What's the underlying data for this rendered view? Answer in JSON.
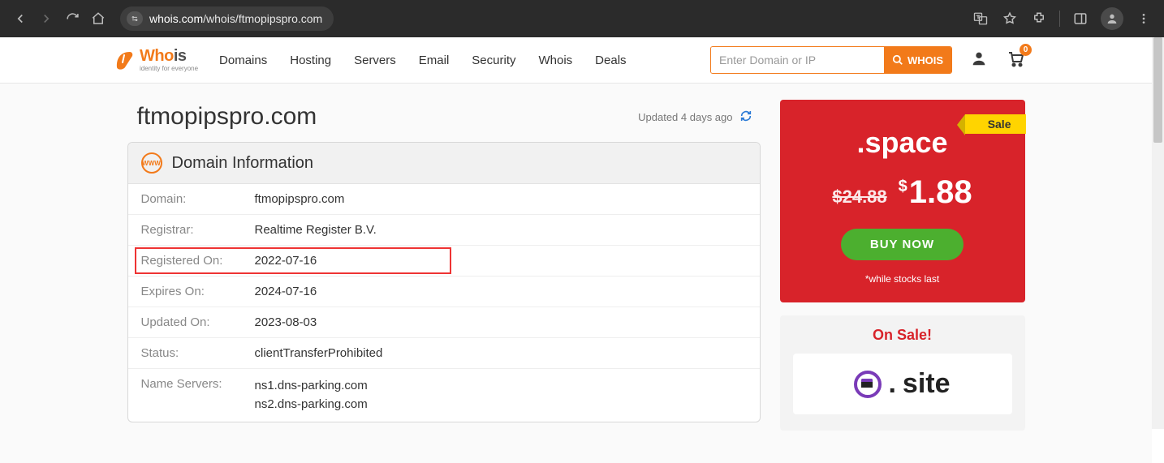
{
  "chrome": {
    "url_domain": "whois.com",
    "url_path": "/whois/ftmopipspro.com"
  },
  "logo": {
    "word_o": "Wh",
    "word_o2": "o",
    "word_rest": "is",
    "tagline": "identity for everyone"
  },
  "nav": {
    "items": [
      "Domains",
      "Hosting",
      "Servers",
      "Email",
      "Security",
      "Whois",
      "Deals"
    ]
  },
  "search": {
    "placeholder": "Enter Domain or IP",
    "button": "WHOIS"
  },
  "cart": {
    "count": "0"
  },
  "page": {
    "title": "ftmopipspro.com",
    "updated": "Updated 4 days ago"
  },
  "panel": {
    "title": "Domain Information",
    "www": "WWW",
    "rows": {
      "domain_k": "Domain:",
      "domain_v": "ftmopipspro.com",
      "registrar_k": "Registrar:",
      "registrar_v": "Realtime Register B.V.",
      "registered_k": "Registered On:",
      "registered_v": "2022-07-16",
      "expires_k": "Expires On:",
      "expires_v": "2024-07-16",
      "updated_k": "Updated On:",
      "updated_v": "2023-08-03",
      "status_k": "Status:",
      "status_v": "clientTransferProhibited",
      "ns_k": "Name Servers:",
      "ns_v1": "ns1.dns-parking.com",
      "ns_v2": "ns2.dns-parking.com"
    }
  },
  "promo1": {
    "sale": "Sale",
    "domain": ".space",
    "old": "$24.88",
    "new_cur": "$",
    "new": "1.88",
    "buy": "BUY NOW",
    "note": "*while stocks last"
  },
  "promo2": {
    "title": "On Sale!",
    "dot": ".",
    "word": "site"
  }
}
